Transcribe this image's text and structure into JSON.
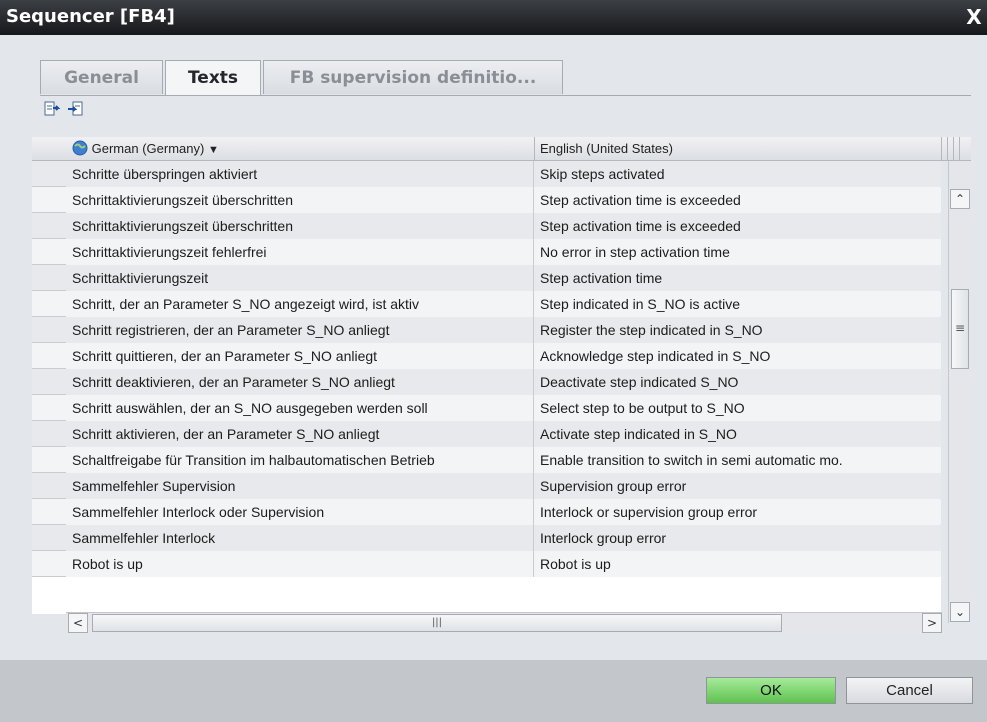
{
  "window": {
    "title": "Sequencer [FB4]",
    "close_glyph": "X"
  },
  "tabs": [
    {
      "label": "General",
      "active": false
    },
    {
      "label": "Texts",
      "active": true
    },
    {
      "label": "FB supervision definitio...",
      "active": false
    }
  ],
  "toolbar": {
    "export_icon": "export-icon",
    "import_icon": "import-icon"
  },
  "table": {
    "columns": [
      {
        "label": "German (Germany)",
        "icon": "globe-icon",
        "has_dropdown": true
      },
      {
        "label": "English (United States)"
      }
    ],
    "rows": [
      {
        "de": "Schritte überspringen aktiviert",
        "en": "Skip steps activated"
      },
      {
        "de": "Schrittaktivierungszeit überschritten",
        "en": "Step activation time is exceeded"
      },
      {
        "de": "Schrittaktivierungszeit überschritten",
        "en": "Step activation time is exceeded"
      },
      {
        "de": "Schrittaktivierungszeit fehlerfrei",
        "en": "No error in step activation time"
      },
      {
        "de": "Schrittaktivierungszeit",
        "en": "Step activation time"
      },
      {
        "de": "Schritt, der an Parameter S_NO angezeigt wird, ist aktiv",
        "en": "Step indicated in S_NO is active"
      },
      {
        "de": "Schritt registrieren, der an Parameter S_NO anliegt",
        "en": "Register the step indicated in S_NO"
      },
      {
        "de": "Schritt quittieren, der an Parameter S_NO anliegt",
        "en": "Acknowledge step indicated in S_NO"
      },
      {
        "de": "Schritt deaktivieren, der an Parameter S_NO anliegt",
        "en": "Deactivate step indicated S_NO"
      },
      {
        "de": "Schritt auswählen, der an S_NO ausgegeben werden soll",
        "en": "Select step to be output to S_NO"
      },
      {
        "de": "Schritt aktivieren, der an Parameter S_NO anliegt",
        "en": "Activate step indicated in S_NO"
      },
      {
        "de": "Schaltfreigabe für Transition im halbautomatischen Betrieb",
        "en": "Enable transition to switch in semi automatic mo."
      },
      {
        "de": "Sammelfehler Supervision",
        "en": "Supervision group error"
      },
      {
        "de": "Sammelfehler Interlock oder Supervision",
        "en": "Interlock or supervision group error"
      },
      {
        "de": "Sammelfehler Interlock",
        "en": "Interlock group error"
      },
      {
        "de": "Robot is up",
        "en": "Robot is up"
      }
    ]
  },
  "scrollbars": {
    "up_glyph": "⌃",
    "down_glyph": "⌄",
    "left_glyph": "<",
    "right_glyph": ">",
    "v_grip": "≡",
    "h_grip": "|||"
  },
  "buttons": {
    "ok": "OK",
    "cancel": "Cancel"
  },
  "colors": {
    "ok_accent": "#6cc95c"
  }
}
